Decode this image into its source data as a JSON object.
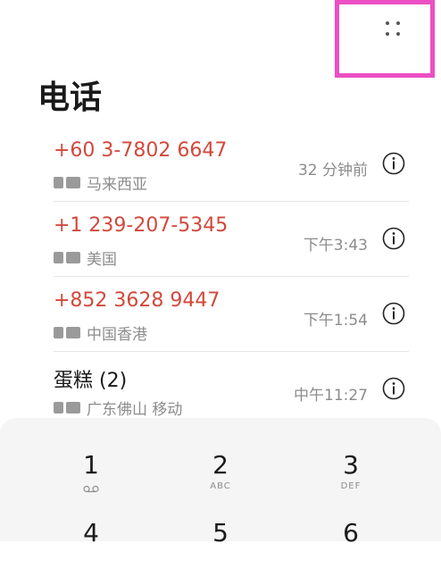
{
  "header": {
    "title": "电话"
  },
  "calls": [
    {
      "number": "+60 3-7802 6647",
      "location": "马来西亚",
      "time": "32 分钟前",
      "known": false
    },
    {
      "number": "+1 239-207-5345",
      "location": "美国",
      "time": "下午3:43",
      "known": false
    },
    {
      "number": "+852 3628 9447",
      "location": "中国香港",
      "time": "下午1:54",
      "known": false
    },
    {
      "number": "蛋糕 (2)",
      "location": "广东佛山 移动",
      "time": "中午11:27",
      "known": true
    }
  ],
  "dialpad": {
    "keys": [
      {
        "digit": "1",
        "letters": "voicemail-icon"
      },
      {
        "digit": "2",
        "letters": "ABC"
      },
      {
        "digit": "3",
        "letters": "DEF"
      },
      {
        "digit": "4",
        "letters": ""
      },
      {
        "digit": "5",
        "letters": ""
      },
      {
        "digit": "6",
        "letters": ""
      }
    ]
  },
  "colors": {
    "missed": "#d1493b",
    "highlight": "#ec4fc4"
  }
}
